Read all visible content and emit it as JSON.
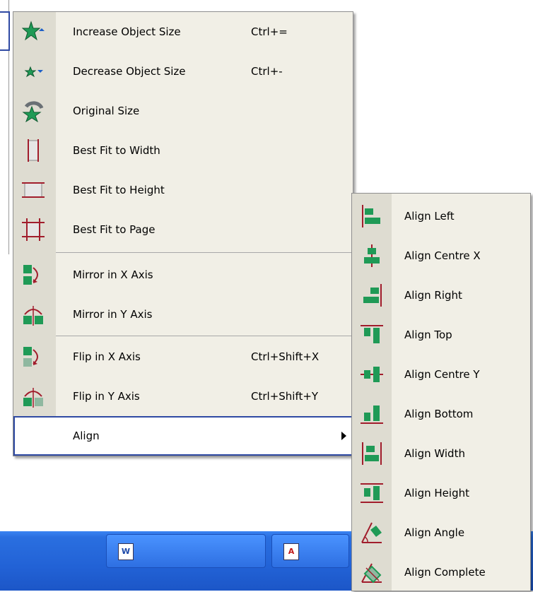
{
  "colors": {
    "menu_bg": "#f1efe6",
    "gutter": "#dedcd1",
    "selection_border": "#2f4aa3",
    "icon_green": "#1f9a56",
    "icon_red": "#a11d2c",
    "taskbar": "#2262d6"
  },
  "main_menu": {
    "items": [
      {
        "label": "Increase Object Size",
        "shortcut": "Ctrl+=",
        "icon": "star-grow-icon"
      },
      {
        "label": "Decrease Object Size",
        "shortcut": "Ctrl+-",
        "icon": "star-shrink-icon"
      },
      {
        "label": "Original Size",
        "shortcut": "",
        "icon": "star-reset-icon"
      },
      {
        "label": "Best Fit to Width",
        "shortcut": "",
        "icon": "fit-width-icon"
      },
      {
        "label": "Best Fit to Height",
        "shortcut": "",
        "icon": "fit-height-icon"
      },
      {
        "label": "Best Fit to Page",
        "shortcut": "",
        "icon": "fit-page-icon"
      },
      {
        "label": "Mirror in X Axis",
        "shortcut": "",
        "icon": "mirror-x-icon"
      },
      {
        "label": "Mirror in Y Axis",
        "shortcut": "",
        "icon": "mirror-y-icon"
      },
      {
        "label": "Flip in X Axis",
        "shortcut": "Ctrl+Shift+X",
        "icon": "flip-x-icon"
      },
      {
        "label": "Flip in Y Axis",
        "shortcut": "Ctrl+Shift+Y",
        "icon": "flip-y-icon"
      },
      {
        "label": "Align",
        "shortcut": "",
        "icon": "",
        "submenu": true
      }
    ]
  },
  "align_submenu": {
    "items": [
      {
        "label": "Align Left",
        "icon": "align-left-icon"
      },
      {
        "label": "Align Centre X",
        "icon": "align-centre-x-icon"
      },
      {
        "label": "Align Right",
        "icon": "align-right-icon"
      },
      {
        "label": "Align Top",
        "icon": "align-top-icon"
      },
      {
        "label": "Align Centre Y",
        "icon": "align-centre-y-icon"
      },
      {
        "label": "Align Bottom",
        "icon": "align-bottom-icon"
      },
      {
        "label": "Align Width",
        "icon": "align-width-icon"
      },
      {
        "label": "Align Height",
        "icon": "align-height-icon"
      },
      {
        "label": "Align Angle",
        "icon": "align-angle-icon"
      },
      {
        "label": "Align Complete",
        "icon": "align-complete-icon"
      }
    ]
  },
  "taskbar": {
    "buttons": [
      {
        "icon": "word-document-icon",
        "glyph": "W"
      },
      {
        "icon": "pdf-document-icon",
        "glyph": "A"
      }
    ]
  }
}
